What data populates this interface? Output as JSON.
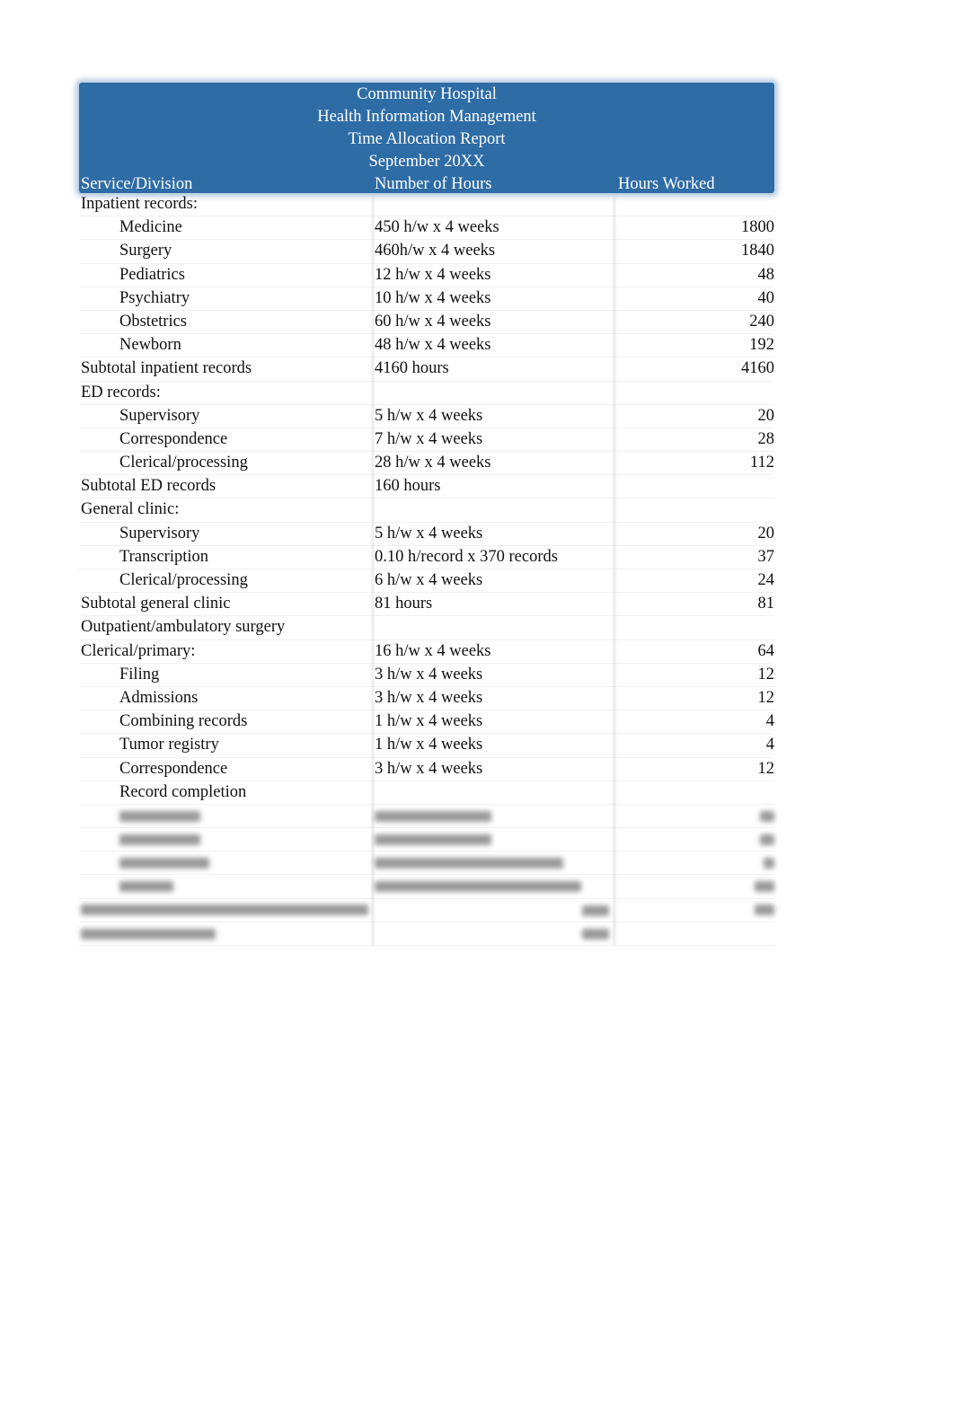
{
  "report": {
    "title_lines": [
      "Community Hospital",
      "Health Information Management",
      "Time Allocation Report",
      "September 20XX"
    ],
    "columns": [
      "Service/Division",
      "Number of Hours",
      "Hours Worked"
    ],
    "header_color": "#2e6ca6",
    "rows": [
      {
        "name": "Inpatient records:",
        "formula": "",
        "hours": "",
        "indent": false
      },
      {
        "name": "Medicine",
        "formula": "450 h/w x 4 weeks",
        "hours": "1800",
        "indent": true
      },
      {
        "name": "Surgery",
        "formula": "460h/w x 4 weeks",
        "hours": "1840",
        "indent": true
      },
      {
        "name": "Pediatrics",
        "formula": "12 h/w x 4 weeks",
        "hours": "48",
        "indent": true
      },
      {
        "name": "Psychiatry",
        "formula": "10 h/w x 4 weeks",
        "hours": "40",
        "indent": true
      },
      {
        "name": "Obstetrics",
        "formula": "60 h/w x 4 weeks",
        "hours": "240",
        "indent": true
      },
      {
        "name": "Newborn",
        "formula": "48 h/w x 4 weeks",
        "hours": "192",
        "indent": true
      },
      {
        "name": "Subtotal inpatient records",
        "formula": "4160 hours",
        "hours": "4160",
        "indent": false
      },
      {
        "name": "ED records:",
        "formula": "",
        "hours": "",
        "indent": false
      },
      {
        "name": "Supervisory",
        "formula": "5 h/w x 4 weeks",
        "hours": "20",
        "indent": true
      },
      {
        "name": "Correspondence",
        "formula": "7 h/w x 4 weeks",
        "hours": "28",
        "indent": true
      },
      {
        "name": "Clerical/processing",
        "formula": "28 h/w x 4 weeks",
        "hours": "112",
        "indent": true
      },
      {
        "name": "Subtotal ED records",
        "formula": "160 hours",
        "hours": "",
        "indent": false
      },
      {
        "name": "General clinic:",
        "formula": "",
        "hours": "",
        "indent": false
      },
      {
        "name": "Supervisory",
        "formula": "5 h/w x 4 weeks",
        "hours": "20",
        "indent": true
      },
      {
        "name": "Transcription",
        "formula": "0.10 h/record x 370 records",
        "hours": "37",
        "indent": true
      },
      {
        "name": "Clerical/processing",
        "formula": "6 h/w x 4 weeks",
        "hours": "24",
        "indent": true
      },
      {
        "name": "Subtotal general clinic",
        "formula": "81 hours",
        "hours": "81",
        "indent": false
      },
      {
        "name": "Outpatient/ambulatory surgery",
        "formula": "",
        "hours": "",
        "indent": false
      },
      {
        "name": "Clerical/primary:",
        "formula": "16 h/w x 4 weeks",
        "hours": "64",
        "indent": false
      },
      {
        "name": "Filing",
        "formula": "3 h/w x 4 weeks",
        "hours": "12",
        "indent": true
      },
      {
        "name": "Admissions",
        "formula": "3 h/w x 4 weeks",
        "hours": "12",
        "indent": true
      },
      {
        "name": "Combining records",
        "formula": "1 h/w x 4 weeks",
        "hours": "4",
        "indent": true
      },
      {
        "name": "Tumor registry",
        "formula": "1 h/w x 4 weeks",
        "hours": "4",
        "indent": true
      },
      {
        "name": "Correspondence",
        "formula": "3 h/w x 4 weeks",
        "hours": "12",
        "indent": true
      },
      {
        "name": "Record completion",
        "formula": "",
        "hours": "",
        "indent": true
      }
    ],
    "blurred_row_count": 5
  }
}
